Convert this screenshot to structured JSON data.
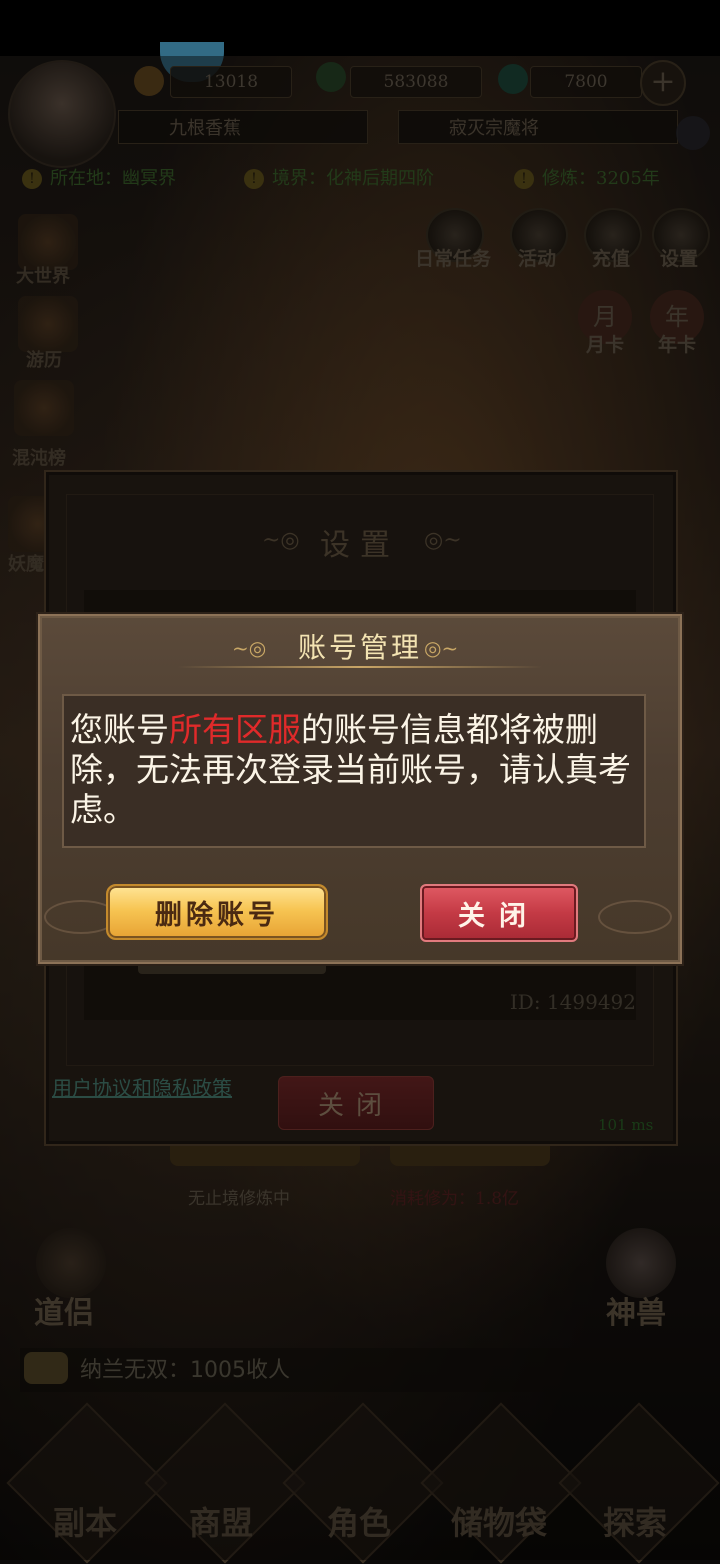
{
  "hud": {
    "res1": "13018",
    "res2": "583088",
    "res3": "7800",
    "plus": "+",
    "name_left": "九根香蕉",
    "name_right": "寂灭宗魔将",
    "location": "所在地：幽冥界",
    "realm": "境界：化神后期四阶",
    "cultivation": "修炼：3205年"
  },
  "left_side": [
    "大世界",
    "游历",
    "混沌榜",
    "妖魔"
  ],
  "top_icons": [
    "日常任务",
    "活动",
    "充值",
    "设置"
  ],
  "cards": [
    "月卡",
    "年卡"
  ],
  "card_marks": [
    "月",
    "年"
  ],
  "settings": {
    "title": "设置",
    "id": "ID: 1499492",
    "policy": "用户协议和隐私政策",
    "close": "关闭",
    "ping": "101 ms"
  },
  "lower": {
    "left_status": "无止境修炼中",
    "right_status": "消耗修为：1.8亿",
    "daolv": "道侣",
    "shenshou": "神兽"
  },
  "chat": {
    "text": "纳兰无双：1005收人"
  },
  "nav": [
    "副本",
    "商盟",
    "角色",
    "储物袋",
    "探索"
  ],
  "dialog": {
    "title": "账号管理",
    "msg_part1": "您账号",
    "msg_highlight": "所有区服",
    "msg_part2": "的账号信息都将被删除，无法再次登录当前账号，请认真考虑。",
    "delete_btn": "删除账号",
    "close_btn": "关闭"
  },
  "colors": {
    "highlight": "#e02a2a",
    "delete_btn": "#f7c553",
    "close_btn": "#c43a45"
  }
}
